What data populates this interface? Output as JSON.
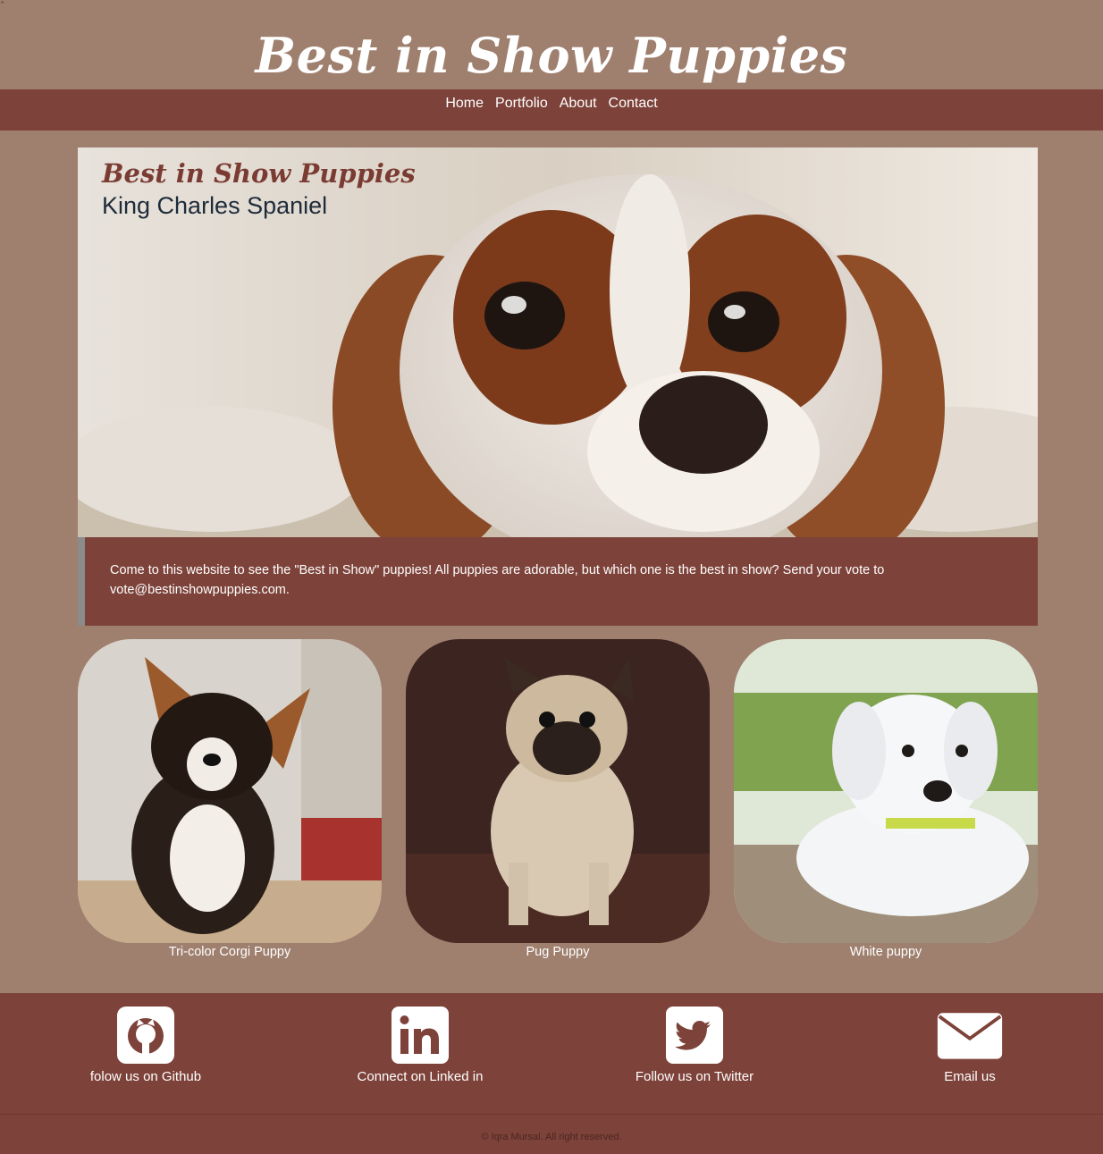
{
  "header": {
    "title": "Best in Show Puppies"
  },
  "nav": {
    "items": [
      {
        "label": "Home"
      },
      {
        "label": "Portfolio"
      },
      {
        "label": "About"
      },
      {
        "label": "Contact"
      }
    ]
  },
  "hero": {
    "brand": "Best in Show Puppies",
    "subtitle": "King Charles Spaniel"
  },
  "intro": {
    "text": "Come to this website to see the \"Best in Show\" puppies! All puppies are adorable, but which one is the best in show? Send your vote to vote@bestinshowpuppies.com."
  },
  "gallery": {
    "items": [
      {
        "caption": "Tri-color Corgi Puppy"
      },
      {
        "caption": "Pug Puppy"
      },
      {
        "caption": "White puppy"
      }
    ]
  },
  "footer": {
    "links": [
      {
        "label": "folow us on Github",
        "icon": "github-icon"
      },
      {
        "label": "Connect on Linked in",
        "icon": "linkedin-icon"
      },
      {
        "label": "Follow us on Twitter",
        "icon": "twitter-icon"
      },
      {
        "label": "Email us",
        "icon": "envelope-icon"
      }
    ],
    "copyright": "© Iqra Mursal. All right reserved."
  },
  "colors": {
    "page_background": "#9f7f6e",
    "accent": "#7d4239",
    "intro_border": "#8b8b8b",
    "hero_brand": "#7a3b33",
    "hero_subtitle": "#1d2b3a"
  }
}
